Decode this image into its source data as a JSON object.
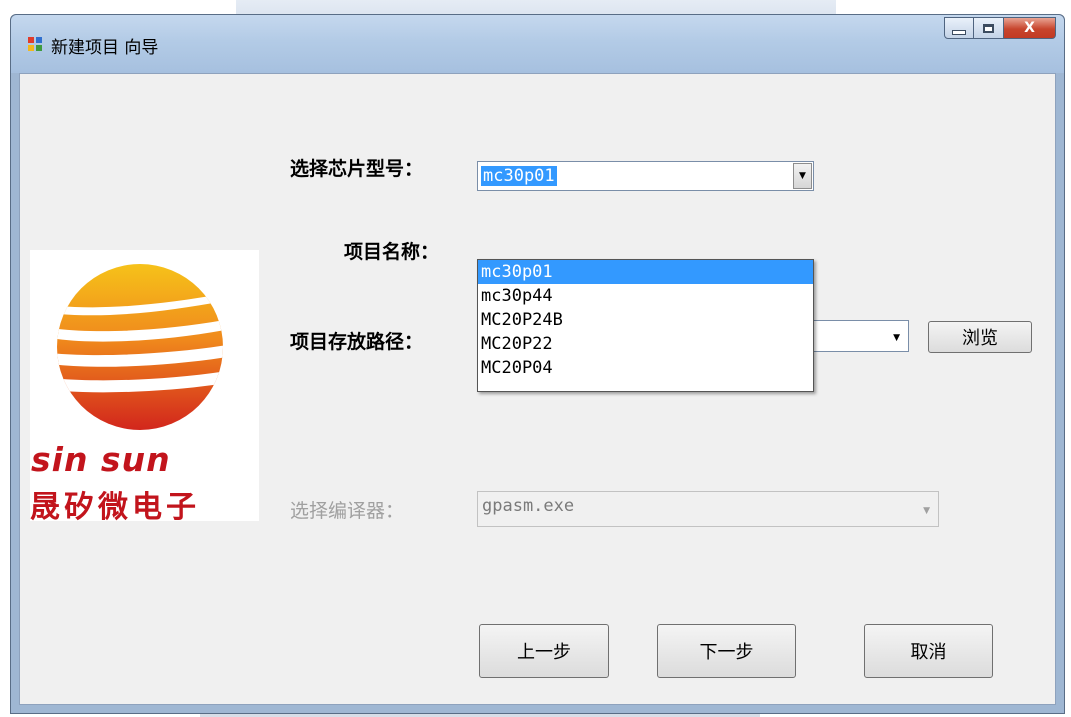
{
  "window": {
    "title": "新建项目 向导",
    "close_glyph": "X"
  },
  "form": {
    "chip_label": "选择芯片型号：",
    "chip_value": "mc30p01",
    "chip_options": [
      "mc30p01",
      "mc30p44",
      "MC20P24B",
      "MC20P22",
      "MC20P04"
    ],
    "project_name_label": "项目名称：",
    "project_path_label": "项目存放路径：",
    "browse_label": "浏览",
    "compiler_label": "选择编译器：",
    "compiler_value": "gpasm.exe"
  },
  "logo": {
    "brand_en": "sin sun",
    "brand_cn": "晟矽微电子"
  },
  "footer": {
    "prev_label": "上一步",
    "next_label": "下一步",
    "cancel_label": "取消"
  },
  "colors": {
    "selection": "#3399ff",
    "brand_red": "#c2141c",
    "titlebar": "#b3cbe6"
  }
}
